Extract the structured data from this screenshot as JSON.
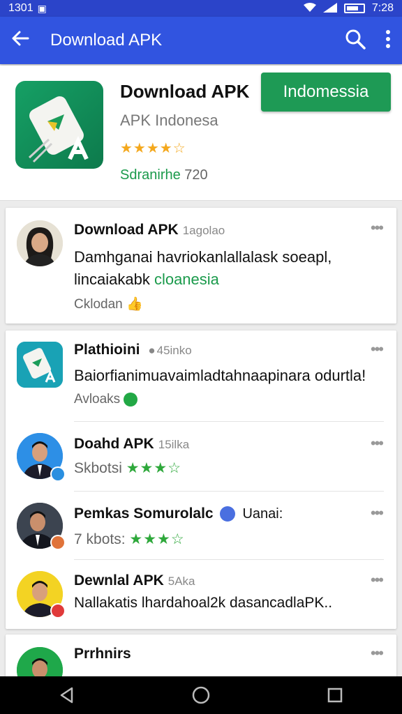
{
  "status_bar": {
    "time_left": "1301",
    "time_right": "7:28"
  },
  "app_bar": {
    "title": "Download APK"
  },
  "header": {
    "app_name": "Download APK",
    "developer": "APK Indonesa",
    "rating_stars": "★★★★☆",
    "install_label": "Sdranirhe",
    "install_count": "720",
    "install_button": "Indomessia"
  },
  "reviews": [
    {
      "name": "Download APK",
      "meta": "1agolao",
      "text_line1": "Damhganai havriokanlallalask soeapl,",
      "text_line2_a": "lincaiakabk ",
      "text_line2_b": "cloanesia",
      "sub": "Cklodan",
      "avatar": "woman-avatar"
    },
    {
      "name": "Plathioini",
      "meta": "45inko",
      "text_line1": "Baiorfianimuavaimladtahnaapinara odurtla!",
      "sub": "Avloaks",
      "avatar": "app-avatar"
    },
    {
      "name": "Doahd APK",
      "meta": "15ilka",
      "sub": "Skbotsi",
      "stars": "★★★☆",
      "avatar": "man-avatar-blue"
    },
    {
      "name": "Pemkas Somurolalc",
      "meta": "Uanai:",
      "sub": "7 kbots:",
      "stars": "★★★☆",
      "avatar": "man-avatar-dark"
    },
    {
      "name": "Dewnlal APK",
      "meta": "5Aka",
      "text_line1": "Nallakatis lhardahoal2k dasancadlaPK..",
      "avatar": "man-avatar-yellow"
    },
    {
      "name": "Prrhnirs",
      "avatar": "man-avatar-green"
    }
  ],
  "colors": {
    "status_bar": "#2b44c9",
    "app_bar": "#3154e0",
    "install_button": "#1e9a55",
    "star_orange": "#f4a81d",
    "star_green": "#2ea83b"
  }
}
